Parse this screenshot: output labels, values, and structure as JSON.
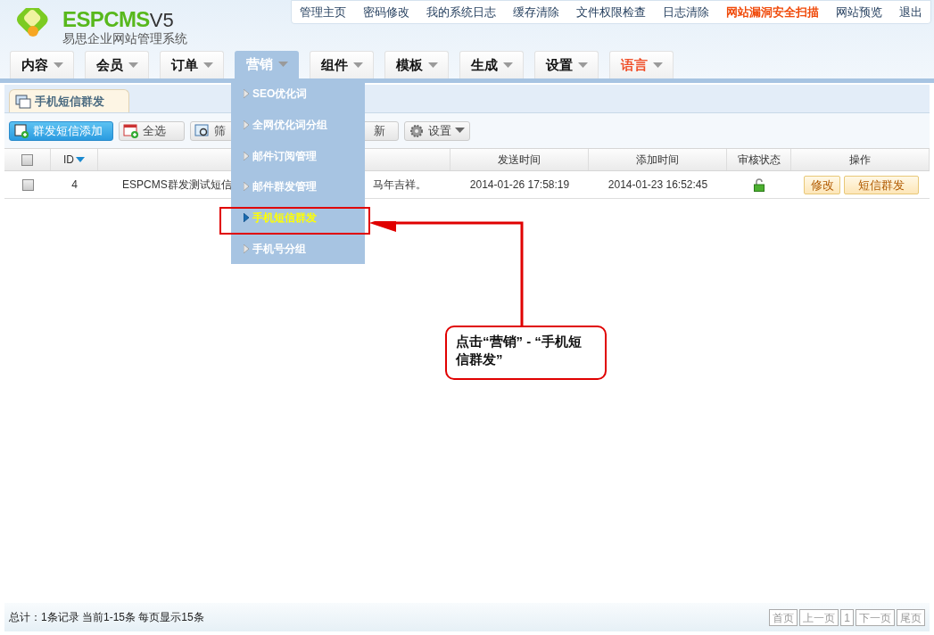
{
  "logo": {
    "brand": "ESPCMS",
    "version": "V5",
    "subtitle": "易思企业网站管理系统"
  },
  "top_links": [
    {
      "label": "管理主页",
      "highlight": false
    },
    {
      "label": "密码修改",
      "highlight": false
    },
    {
      "label": "我的系统日志",
      "highlight": false
    },
    {
      "label": "缓存清除",
      "highlight": false
    },
    {
      "label": "文件权限检查",
      "highlight": false
    },
    {
      "label": "日志清除",
      "highlight": false
    },
    {
      "label": "网站漏洞安全扫描",
      "highlight": true
    },
    {
      "label": "网站预览",
      "highlight": false
    },
    {
      "label": "退出",
      "highlight": false
    }
  ],
  "nav": [
    {
      "label": "内容",
      "selected": false,
      "highlight": false
    },
    {
      "label": "会员",
      "selected": false,
      "highlight": false
    },
    {
      "label": "订单",
      "selected": false,
      "highlight": false
    },
    {
      "label": "营销",
      "selected": true,
      "highlight": false
    },
    {
      "label": "组件",
      "selected": false,
      "highlight": false
    },
    {
      "label": "模板",
      "selected": false,
      "highlight": false
    },
    {
      "label": "生成",
      "selected": false,
      "highlight": false
    },
    {
      "label": "设置",
      "selected": false,
      "highlight": false
    },
    {
      "label": "语言",
      "selected": false,
      "highlight": true
    }
  ],
  "dropdown": [
    {
      "label": "SEO优化词",
      "selected": false
    },
    {
      "label": "全网优化词分组",
      "selected": false
    },
    {
      "label": "邮件订阅管理",
      "selected": false
    },
    {
      "label": "邮件群发管理",
      "selected": false
    },
    {
      "label": "手机短信群发",
      "selected": true
    },
    {
      "label": "手机号分组",
      "selected": false
    }
  ],
  "page_tab": "手机短信群发",
  "toolbar": [
    {
      "kind": "primary",
      "label": "群发短信添加"
    },
    {
      "kind": "select",
      "label": "全选"
    },
    {
      "kind": "filter",
      "label": "筛"
    },
    {
      "kind": "refresh",
      "label": "新"
    },
    {
      "kind": "settings",
      "label": "设置"
    }
  ],
  "table": {
    "select_all": {
      "checked": false
    },
    "columns": [
      "ID",
      "发送时间",
      "添加时间",
      "审核状态",
      "操作"
    ],
    "rows": [
      {
        "checked": false,
        "id": "4",
        "content_start": "ESPCMS群发测试短信",
        "content_end": "马年吉祥。",
        "send_time": "2014-01-26 17:58:19",
        "add_time": "2014-01-23 16:52:45",
        "unlocked": true,
        "actions": [
          "修改",
          "短信群发"
        ]
      }
    ]
  },
  "callout": "点击“营销” - “手机短信群发”",
  "footer": {
    "summary": "总计：1条记录 当前1-15条 每页显示15条",
    "pager": [
      "首页",
      "上一页",
      "1",
      "下一页",
      "尾页"
    ]
  }
}
